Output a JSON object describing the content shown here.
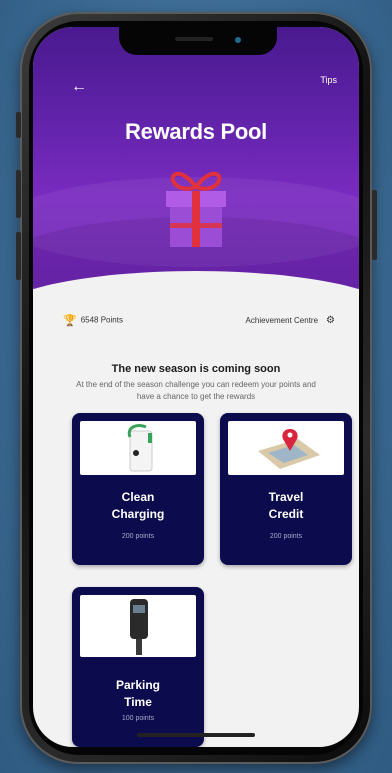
{
  "header": {
    "back_icon": "arrow-left-icon",
    "tips_label": "Tips",
    "title": "Rewards Pool"
  },
  "stats": {
    "points": "6548 Points",
    "achievement": "Achievement Centre"
  },
  "season": {
    "title": "The new season is coming soon",
    "description": "At the end of the season challenge you can redeem your points and have a chance to get the rewards"
  },
  "rewards": [
    {
      "name_line1": "Clean",
      "name_line2": "Charging",
      "points": "200 points",
      "icon": "ev-charger-icon"
    },
    {
      "name_line1": "Travel",
      "name_line2": "Credit",
      "points": "200 points",
      "icon": "map-pin-icon"
    },
    {
      "name_line1": "Parking",
      "name_line2": "Time",
      "points": "100 points",
      "icon": "parking-meter-icon"
    }
  ],
  "colors": {
    "hero_purple": "#6a24b0",
    "card_navy": "#0c0b4e",
    "gift_body": "#9b4dd6",
    "gift_ribbon": "#e0313c"
  }
}
